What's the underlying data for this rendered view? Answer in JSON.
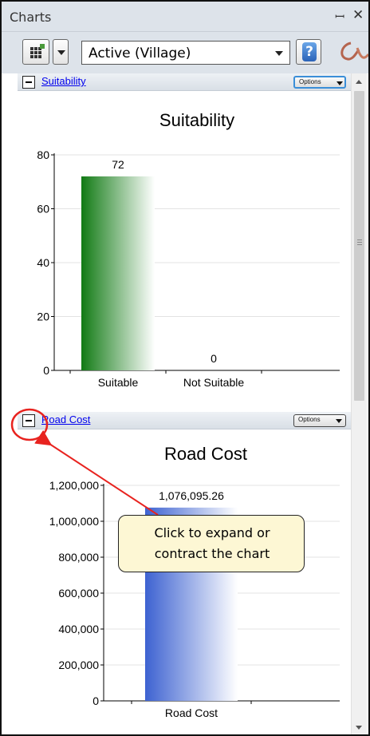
{
  "window": {
    "title": "Charts",
    "pin_glyph": "ꟷ",
    "close_glyph": "✕"
  },
  "toolbar": {
    "combo_value": "Active (Village)",
    "help_glyph": "?"
  },
  "sections": [
    {
      "link": "Suitability",
      "options_label": "Options"
    },
    {
      "link": "Road Cost",
      "options_label": "Options"
    }
  ],
  "callout": {
    "line1": "Click to expand or",
    "line2": "contract the chart"
  },
  "colors": {
    "accent_red": "#e8231f",
    "green_bar": "#117a14",
    "blue_bar": "#3d62d1",
    "callout_bg": "#fdf7d4"
  },
  "chart_data": [
    {
      "type": "bar",
      "title": "Suitability",
      "categories": [
        "Suitable",
        "Not Suitable"
      ],
      "values": [
        72,
        0
      ],
      "data_labels": [
        "72",
        "0"
      ],
      "ylim": [
        0,
        80
      ],
      "y_ticks": [
        0,
        20,
        40,
        60,
        80
      ],
      "y_tick_labels": [
        "0",
        "20",
        "40",
        "60",
        "80"
      ],
      "grid": true,
      "color": "#117a14"
    },
    {
      "type": "bar",
      "title": "Road Cost",
      "categories": [
        "Road Cost"
      ],
      "values": [
        1076095.26
      ],
      "data_labels": [
        "1,076,095.26"
      ],
      "ylim": [
        0,
        1200000
      ],
      "y_ticks": [
        0,
        200000,
        400000,
        600000,
        800000,
        1000000,
        1200000
      ],
      "y_tick_labels": [
        "0",
        "200,000",
        "400,000",
        "600,000",
        "800,000",
        "1,000,000",
        "1,200,000"
      ],
      "grid": true,
      "color": "#3d62d1"
    }
  ]
}
